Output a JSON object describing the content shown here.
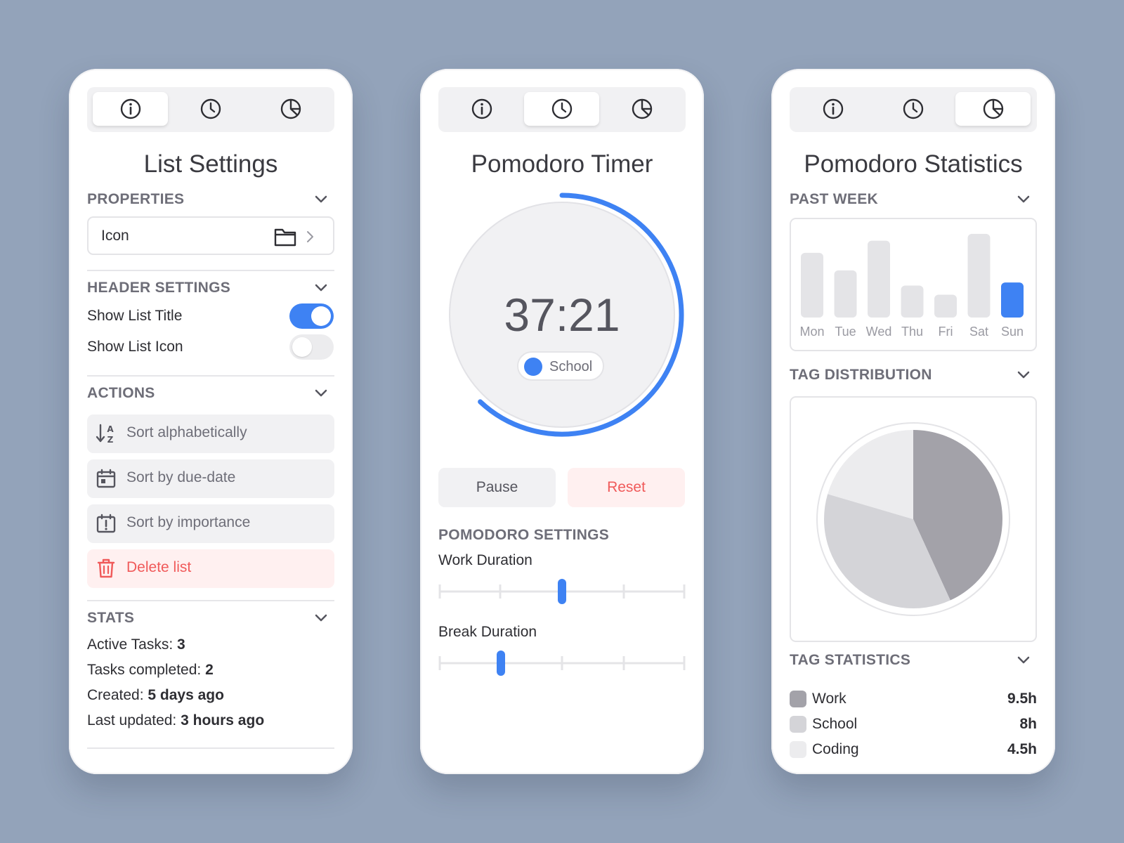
{
  "colors": {
    "accent": "#3e82f3",
    "danger": "#f05a5a",
    "background": "#93a3ba"
  },
  "tabs": {
    "icons": [
      "info-icon",
      "clock-icon",
      "pie-chart-icon"
    ]
  },
  "list_settings": {
    "title": "List Settings",
    "properties": {
      "heading": "PROPERTIES",
      "icon_label": "Icon"
    },
    "header_settings": {
      "heading": "HEADER SETTINGS",
      "show_list_title": {
        "label": "Show List Title",
        "on": true
      },
      "show_list_icon": {
        "label": "Show List Icon",
        "on": false
      }
    },
    "actions": {
      "heading": "ACTIONS",
      "sort_alpha": "Sort alphabetically",
      "sort_due": "Sort by due-date",
      "sort_importance": "Sort by importance",
      "delete": "Delete list"
    },
    "stats": {
      "heading": "STATS",
      "active_label": "Active Tasks:",
      "active_value": "3",
      "completed_label": "Tasks completed:",
      "completed_value": "2",
      "created_label": "Created:",
      "created_value": "5 days ago",
      "updated_label": "Last updated:",
      "updated_value": "3 hours ago"
    }
  },
  "pomodoro_timer": {
    "title": "Pomodoro Timer",
    "time": "37:21",
    "progress_fraction": 0.62,
    "tag": "School",
    "pause_label": "Pause",
    "reset_label": "Reset",
    "settings_heading": "POMODORO SETTINGS",
    "work_label": "Work Duration",
    "work_position": 0.5,
    "break_label": "Break Duration",
    "break_position": 0.25
  },
  "pomodoro_stats": {
    "title": "Pomodoro Statistics",
    "past_week_heading": "PAST WEEK",
    "tag_distribution_heading": "TAG DISTRIBUTION",
    "tag_statistics_heading": "TAG STATISTICS",
    "tags": [
      {
        "name": "Work",
        "value": "9.5h",
        "color": "#a3a2a9"
      },
      {
        "name": "School",
        "value": "8h",
        "color": "#d4d4d8"
      },
      {
        "name": "Coding",
        "value": "4.5h",
        "color": "#ececee"
      }
    ]
  },
  "chart_data": [
    {
      "type": "bar",
      "categories": [
        "Mon",
        "Tue",
        "Wed",
        "Thu",
        "Fri",
        "Sat",
        "Sun"
      ],
      "values": [
        85,
        62,
        101,
        42,
        30,
        110,
        46
      ],
      "highlight_index": 6,
      "ylim": [
        0,
        120
      ],
      "grid": false
    },
    {
      "type": "pie",
      "labels": [
        "Work",
        "School",
        "Coding"
      ],
      "values": [
        9.5,
        8,
        4.5
      ],
      "colors": [
        "#a3a2a9",
        "#d4d4d8",
        "#ececee"
      ]
    }
  ]
}
